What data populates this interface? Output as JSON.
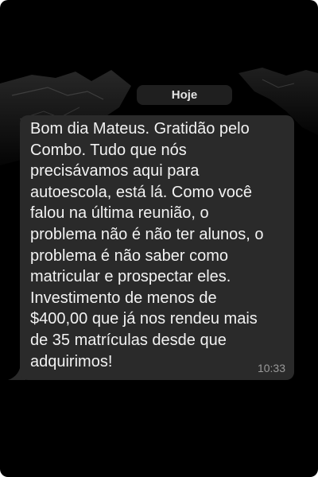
{
  "chat": {
    "date_label": "Hoje",
    "message": {
      "text": "Bom dia Mateus. Gratidão pelo\nCombo. Tudo que nós\nprecisávamos aqui para\nautoescola, está lá. Como você\nfalou na última reunião, o\nproblema não é não ter alunos, o\nproblema é não saber como\nmatricular e prospectar eles.\nInvestimento de menos de\n$400,00 que já nos rendeu mais\nde 35 matrículas desde que\nadquirimos!",
      "time": "10:33"
    }
  },
  "colors": {
    "background": "#000000",
    "bubble": "#2a2a2a",
    "text": "#f2f2f2",
    "timestamp": "#9a9a9a"
  }
}
